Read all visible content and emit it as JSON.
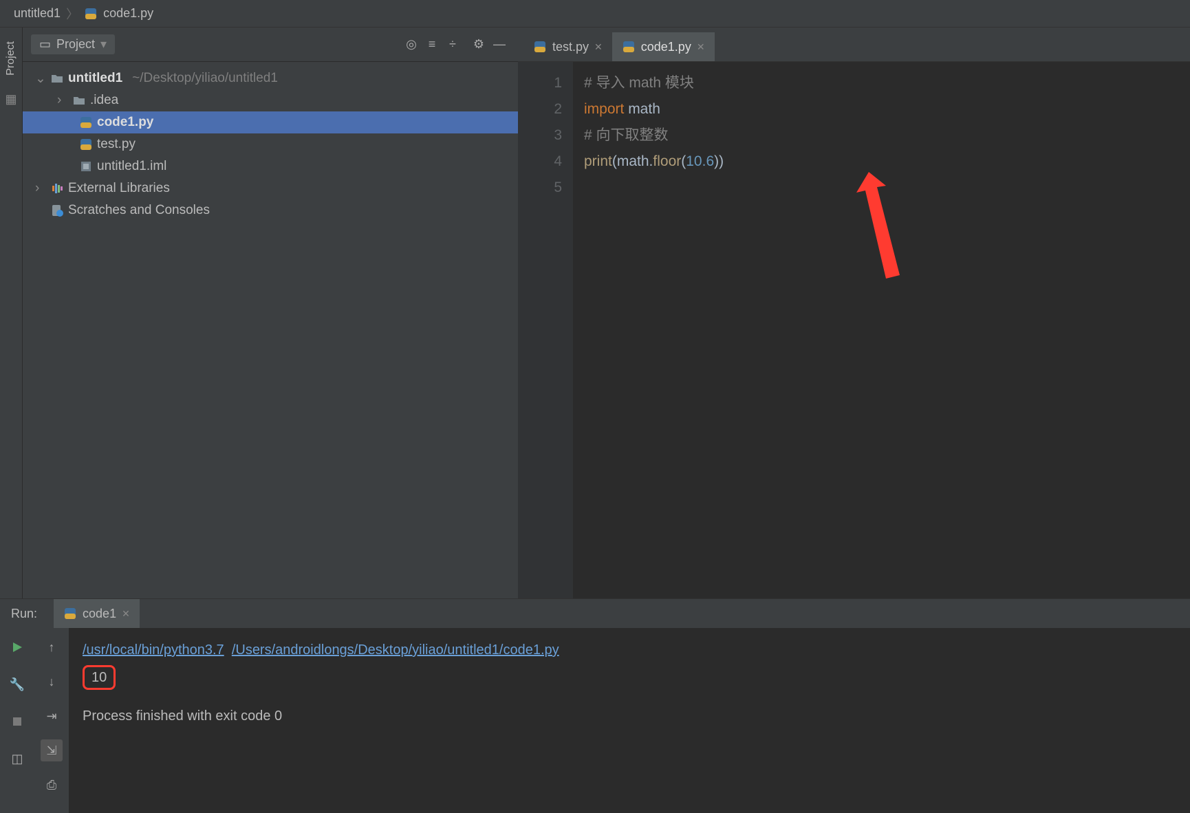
{
  "breadcrumb": {
    "project": "untitled1",
    "file": "code1.py"
  },
  "sidebar_strip": {
    "project_label": "Project"
  },
  "project_panel": {
    "title": "Project",
    "tree": {
      "root_name": "untitled1",
      "root_path": "~/Desktop/yiliao/untitled1",
      "children": [
        {
          "name": ".idea",
          "type": "folder"
        },
        {
          "name": "code1.py",
          "type": "py",
          "selected": true
        },
        {
          "name": "test.py",
          "type": "py"
        },
        {
          "name": "untitled1.iml",
          "type": "iml"
        }
      ],
      "external": "External Libraries",
      "scratches": "Scratches and Consoles"
    }
  },
  "editor": {
    "tabs": [
      {
        "label": "test.py",
        "active": false
      },
      {
        "label": "code1.py",
        "active": true
      }
    ],
    "lines": [
      "1",
      "2",
      "3",
      "4",
      "5"
    ],
    "code": {
      "l1_comment": "# 导入 math 模块",
      "l2_import": "import",
      "l2_math": " math",
      "l3_comment": "# 向下取整数",
      "l4_print": "print",
      "l4_open": "(",
      "l4_math": "math",
      "l4_dot": ".",
      "l4_floor": "floor",
      "l4_open2": "(",
      "l4_num": "10.6",
      "l4_close": "))"
    }
  },
  "run": {
    "label": "Run:",
    "tab": "code1",
    "console": {
      "interp": "/usr/local/bin/python3.7",
      "script": "/Users/androidlongs/Desktop/yiliao/untitled1/code1.py",
      "output": "10",
      "exit": "Process finished with exit code 0"
    }
  }
}
